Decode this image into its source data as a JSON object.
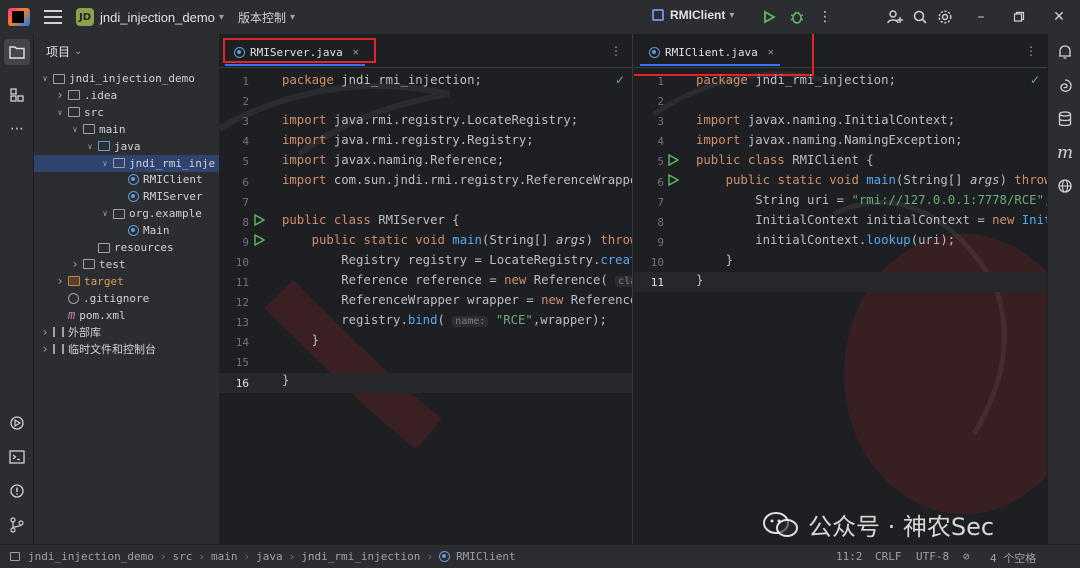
{
  "titlebar": {
    "project_badge": "JD",
    "project_name": "jndi_injection_demo",
    "vcs_label": "版本控制",
    "run_config": "RMIClient"
  },
  "project_panel": {
    "header": "项目",
    "tree": [
      {
        "label": "jndi_injection_demo",
        "type": "folder",
        "depth": 0,
        "expanded": true
      },
      {
        "label": ".idea",
        "type": "folder",
        "depth": 1,
        "expanded": false
      },
      {
        "label": "src",
        "type": "folder",
        "depth": 1,
        "expanded": true
      },
      {
        "label": "main",
        "type": "folder",
        "depth": 2,
        "expanded": true
      },
      {
        "label": "java",
        "type": "src-folder",
        "depth": 3,
        "expanded": true
      },
      {
        "label": "jndi_rmi_inje",
        "type": "package",
        "depth": 4,
        "expanded": true,
        "selected": true
      },
      {
        "label": "RMIClient",
        "type": "class",
        "depth": 5
      },
      {
        "label": "RMIServer",
        "type": "class",
        "depth": 5
      },
      {
        "label": "org.example",
        "type": "package",
        "depth": 4,
        "expanded": true
      },
      {
        "label": "Main",
        "type": "class",
        "depth": 5
      },
      {
        "label": "resources",
        "type": "folder",
        "depth": 3
      },
      {
        "label": "test",
        "type": "folder",
        "depth": 2,
        "expanded": false
      },
      {
        "label": "target",
        "type": "target",
        "depth": 1,
        "expanded": false
      },
      {
        "label": ".gitignore",
        "type": "gitignore",
        "depth": 1
      },
      {
        "label": "pom.xml",
        "type": "maven",
        "depth": 1
      },
      {
        "label": "外部库",
        "type": "library",
        "depth": 0,
        "expanded": false
      },
      {
        "label": "临时文件和控制台",
        "type": "scratch",
        "depth": 0,
        "expanded": false
      }
    ]
  },
  "left_editor": {
    "tab_label": "RMIServer.java",
    "line_numbers": [
      "1",
      "2",
      "3",
      "4",
      "5",
      "6",
      "7",
      "8",
      "9",
      "10",
      "11",
      "12",
      "13",
      "14",
      "15",
      "16"
    ],
    "current_line": "16"
  },
  "right_editor": {
    "tab_label": "RMIClient.java",
    "line_numbers": [
      "1",
      "2",
      "3",
      "4",
      "5",
      "6",
      "7",
      "8",
      "9",
      "10",
      "11"
    ],
    "current_line": "11"
  },
  "statusbar": {
    "breadcrumb": [
      "jndi_injection_demo",
      "src",
      "main",
      "java",
      "jndi_rmi_injection",
      "RMIClient"
    ],
    "position": "11:2",
    "line_ending": "CRLF",
    "encoding": "UTF-8",
    "indent": "4 个空格"
  },
  "watermark": {
    "wechat_text": "公众号 · 神农Sec"
  },
  "colors": {
    "accent": "#3574f0",
    "keyword": "#cf8e6d",
    "string": "#6aab73",
    "function": "#56a8f5",
    "highlight_box": "#e2232a",
    "run_green": "#5fb865"
  }
}
